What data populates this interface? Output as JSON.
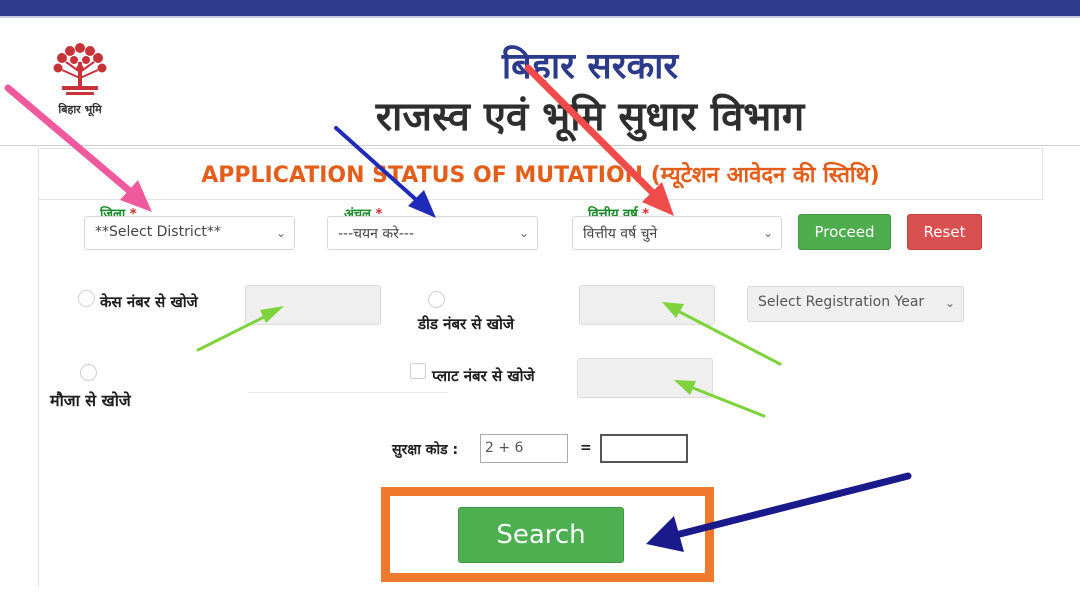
{
  "header": {
    "logo_text": "बिहार भूमि",
    "gov_title": "बिहार सरकार",
    "dept_title": "राजस्व एवं भूमि सुधार विभाग"
  },
  "heading": "APPLICATION STATUS OF MUTATION (म्यूटेशन आवेदन की स्तिथि)",
  "filters": {
    "district_label": "जिला",
    "district_value": "**Select District**",
    "circle_label": "अंचल",
    "circle_value": "---चयन करे---",
    "year_label": "वित्तीय वर्ष",
    "year_value": "वित्तीय वर्ष चुने",
    "required_mark": "*",
    "proceed_label": "Proceed",
    "reset_label": "Reset"
  },
  "search_options": {
    "case_label": "केस नंबर से खोजे",
    "deed_label": "डीड नंबर से खोजे",
    "registration_year_value": "Select Registration Year",
    "mauja_label": "मौजा से खोजे",
    "plot_label": "प्लाट नंबर से खोजे"
  },
  "captcha": {
    "label": "सुरक्षा कोड :",
    "question": "2 + 6",
    "equals": "="
  },
  "search_label": "Search",
  "colors": {
    "top_bar": "#2e3c8e",
    "heading": "#e35d1b",
    "label_green": "#1a8a2a",
    "button_green": "#4ead4e",
    "button_red": "#d95050",
    "highlight_frame": "#ef7a2e",
    "arrow_pink": "#ef5a9d",
    "arrow_blue": "#1f2bb8",
    "arrow_red": "#f04b4b",
    "arrow_lightgreen": "#7ed23c",
    "arrow_navy": "#1b1a8a"
  }
}
